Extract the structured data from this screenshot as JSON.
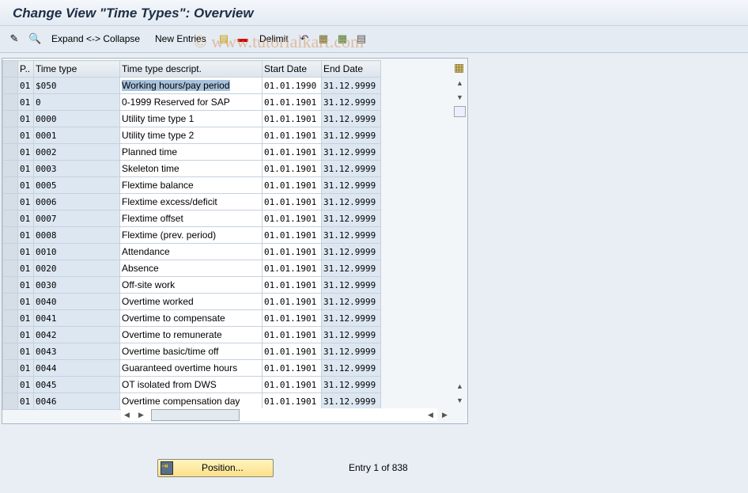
{
  "title": "Change View \"Time Types\": Overview",
  "toolbar": {
    "expand_collapse": "Expand <-> Collapse",
    "new_entries": "New Entries",
    "delimit": "Delimit"
  },
  "watermark": "© www.tutorialkart.com",
  "table": {
    "headers": [
      "P..",
      "Time type",
      "Time type descript.",
      "Start Date",
      "End Date"
    ],
    "rows": [
      [
        "01",
        "$050",
        "Working hours/pay period",
        "01.01.1990",
        "31.12.9999"
      ],
      [
        "01",
        "0",
        "0-1999 Reserved for SAP",
        "01.01.1901",
        "31.12.9999"
      ],
      [
        "01",
        "0000",
        "Utility time type 1",
        "01.01.1901",
        "31.12.9999"
      ],
      [
        "01",
        "0001",
        "Utility time type 2",
        "01.01.1901",
        "31.12.9999"
      ],
      [
        "01",
        "0002",
        "Planned time",
        "01.01.1901",
        "31.12.9999"
      ],
      [
        "01",
        "0003",
        "Skeleton time",
        "01.01.1901",
        "31.12.9999"
      ],
      [
        "01",
        "0005",
        "Flextime balance",
        "01.01.1901",
        "31.12.9999"
      ],
      [
        "01",
        "0006",
        "Flextime excess/deficit",
        "01.01.1901",
        "31.12.9999"
      ],
      [
        "01",
        "0007",
        "Flextime offset",
        "01.01.1901",
        "31.12.9999"
      ],
      [
        "01",
        "0008",
        "Flextime (prev. period)",
        "01.01.1901",
        "31.12.9999"
      ],
      [
        "01",
        "0010",
        "Attendance",
        "01.01.1901",
        "31.12.9999"
      ],
      [
        "01",
        "0020",
        "Absence",
        "01.01.1901",
        "31.12.9999"
      ],
      [
        "01",
        "0030",
        "Off-site work",
        "01.01.1901",
        "31.12.9999"
      ],
      [
        "01",
        "0040",
        "Overtime worked",
        "01.01.1901",
        "31.12.9999"
      ],
      [
        "01",
        "0041",
        "Overtime to compensate",
        "01.01.1901",
        "31.12.9999"
      ],
      [
        "01",
        "0042",
        "Overtime to remunerate",
        "01.01.1901",
        "31.12.9999"
      ],
      [
        "01",
        "0043",
        "Overtime basic/time off",
        "01.01.1901",
        "31.12.9999"
      ],
      [
        "01",
        "0044",
        "Guaranteed overtime hours",
        "01.01.1901",
        "31.12.9999"
      ],
      [
        "01",
        "0045",
        "OT isolated from DWS",
        "01.01.1901",
        "31.12.9999"
      ],
      [
        "01",
        "0046",
        "Overtime compensation day",
        "01.01.1901",
        "31.12.9999"
      ]
    ]
  },
  "footer": {
    "position_button": "Position...",
    "entry_info": "Entry 1 of 838"
  }
}
